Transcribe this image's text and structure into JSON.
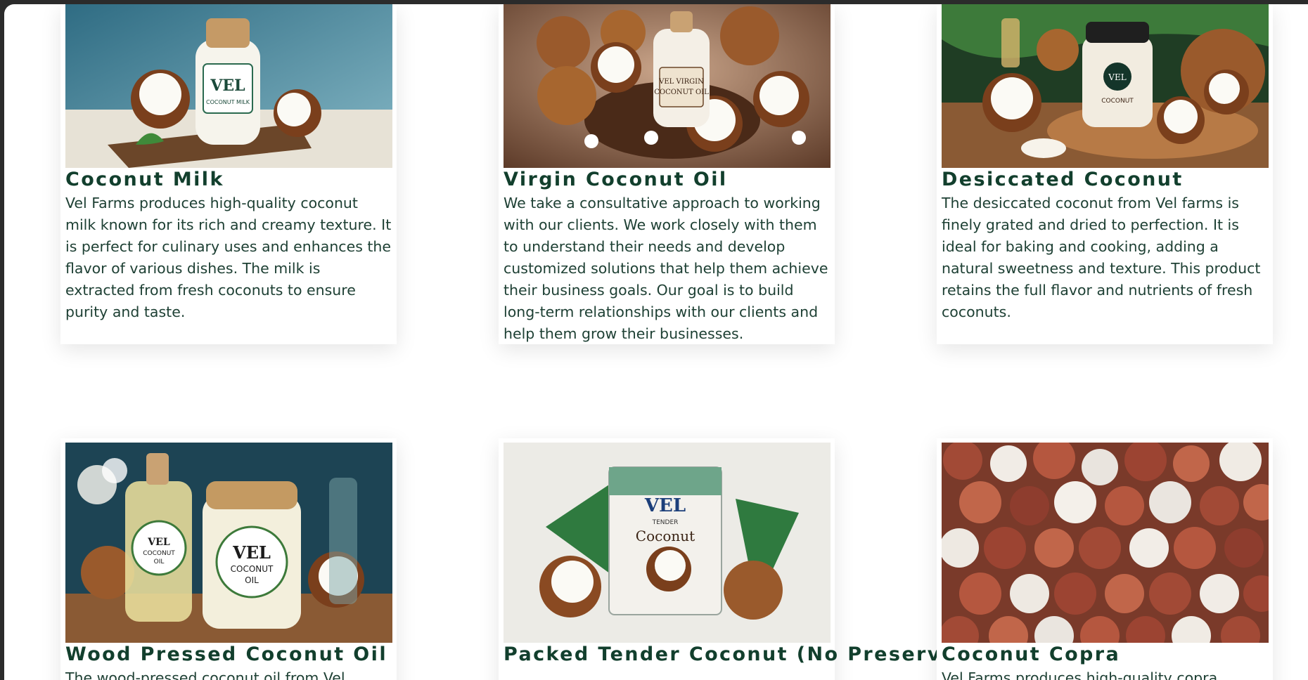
{
  "products": [
    {
      "title": "Coconut Milk",
      "description": "Vel Farms produces high-quality coconut milk known for its rich and creamy texture. It is perfect for culinary uses and enhances the flavor of various dishes. The milk is extracted from fresh coconuts to ensure purity and taste.",
      "label_lines": [
        "VEL",
        "COCONUT MILK"
      ]
    },
    {
      "title": "Virgin Coconut Oil",
      "description": "We take a consultative approach to working with our clients. We work closely with them to understand their needs and develop customized solutions that help them achieve their business goals. Our goal is to build long-term relationships with our clients and help them grow their businesses.",
      "label_lines": [
        "VEL VIRGIN",
        "COCONUT OIL"
      ]
    },
    {
      "title": "Desiccated Coconut",
      "description": "The desiccated coconut from Vel farms is finely grated and dried to perfection. It is ideal for baking and cooking, adding a natural sweetness and texture. This product retains the full flavor and nutrients of fresh coconuts.",
      "label_lines": [
        "VEL",
        "COCONUT"
      ]
    },
    {
      "title": "Wood Pressed Coconut Oil",
      "description": "The wood-pressed coconut oil from Vel",
      "label_lines": [
        "VEL",
        "COCONUT",
        "OIL"
      ]
    },
    {
      "title": "Packed Tender Coconut (No Preservatives)",
      "description": "",
      "label_lines": [
        "VEL",
        "TENDER",
        "Coconut"
      ]
    },
    {
      "title": "Coconut Copra",
      "description": "Vel Farms produces high-quality copra",
      "label_lines": []
    }
  ],
  "colors": {
    "title": "#123f2d",
    "text": "#1e4034",
    "page_background": "#ffffff",
    "frame": "#2b2b2b"
  }
}
